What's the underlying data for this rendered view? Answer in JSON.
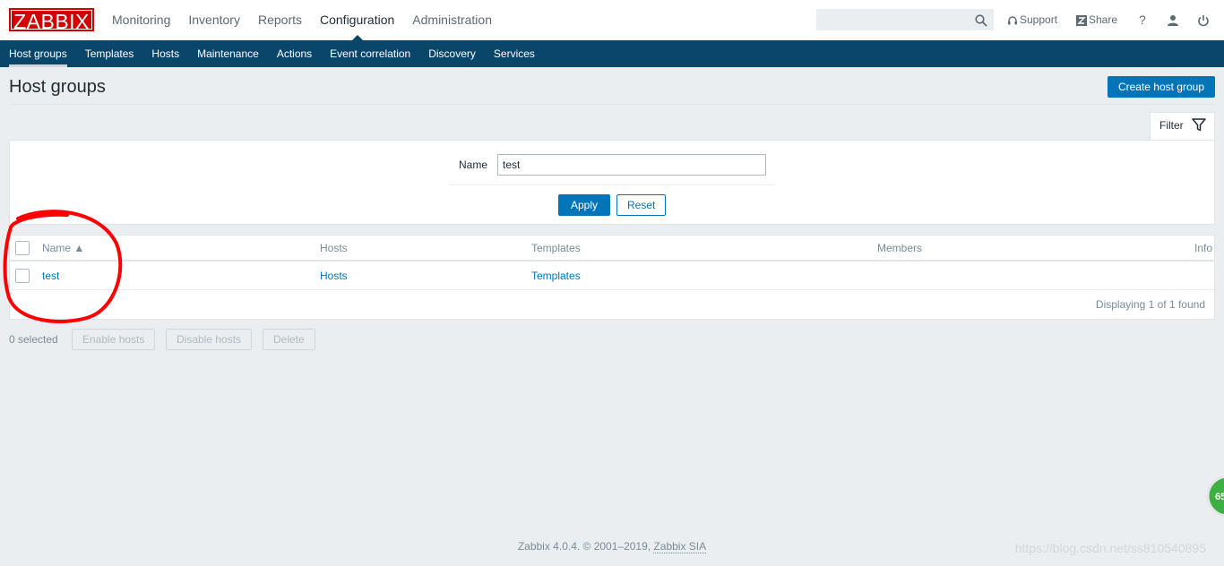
{
  "logo": "ZABBIX",
  "main_menu": [
    {
      "label": "Monitoring"
    },
    {
      "label": "Inventory"
    },
    {
      "label": "Reports"
    },
    {
      "label": "Configuration"
    },
    {
      "label": "Administration"
    }
  ],
  "top_right": {
    "support_label": "Support",
    "share_label": "Share",
    "help_label": "?"
  },
  "subnav": [
    {
      "label": "Host groups"
    },
    {
      "label": "Templates"
    },
    {
      "label": "Hosts"
    },
    {
      "label": "Maintenance"
    },
    {
      "label": "Actions"
    },
    {
      "label": "Event correlation"
    },
    {
      "label": "Discovery"
    },
    {
      "label": "Services"
    }
  ],
  "page": {
    "title": "Host groups",
    "create_button": "Create host group"
  },
  "filter": {
    "tab_label": "Filter",
    "name_label": "Name",
    "name_value": "test",
    "apply_label": "Apply",
    "reset_label": "Reset"
  },
  "table": {
    "headers": {
      "name": "Name ▲",
      "hosts": "Hosts",
      "templates": "Templates",
      "members": "Members",
      "info": "Info"
    },
    "rows": [
      {
        "name": "test",
        "hosts": "Hosts",
        "templates": "Templates"
      }
    ],
    "footer": "Displaying 1 of 1 found"
  },
  "actions": {
    "selected": "0 selected",
    "enable_hosts": "Enable hosts",
    "disable_hosts": "Disable hosts",
    "delete": "Delete"
  },
  "footer": {
    "text": "Zabbix 4.0.4. © 2001–2019, ",
    "link": "Zabbix SIA"
  },
  "watermark": "https://blog.csdn.net/ss810540895",
  "badge_text": "65",
  "colors": {
    "nav_bg": "#0a466a",
    "primary": "#0275b8",
    "logo_red": "#d40000",
    "annotation_red": "#ff0000",
    "badge_green": "#3cb043"
  }
}
